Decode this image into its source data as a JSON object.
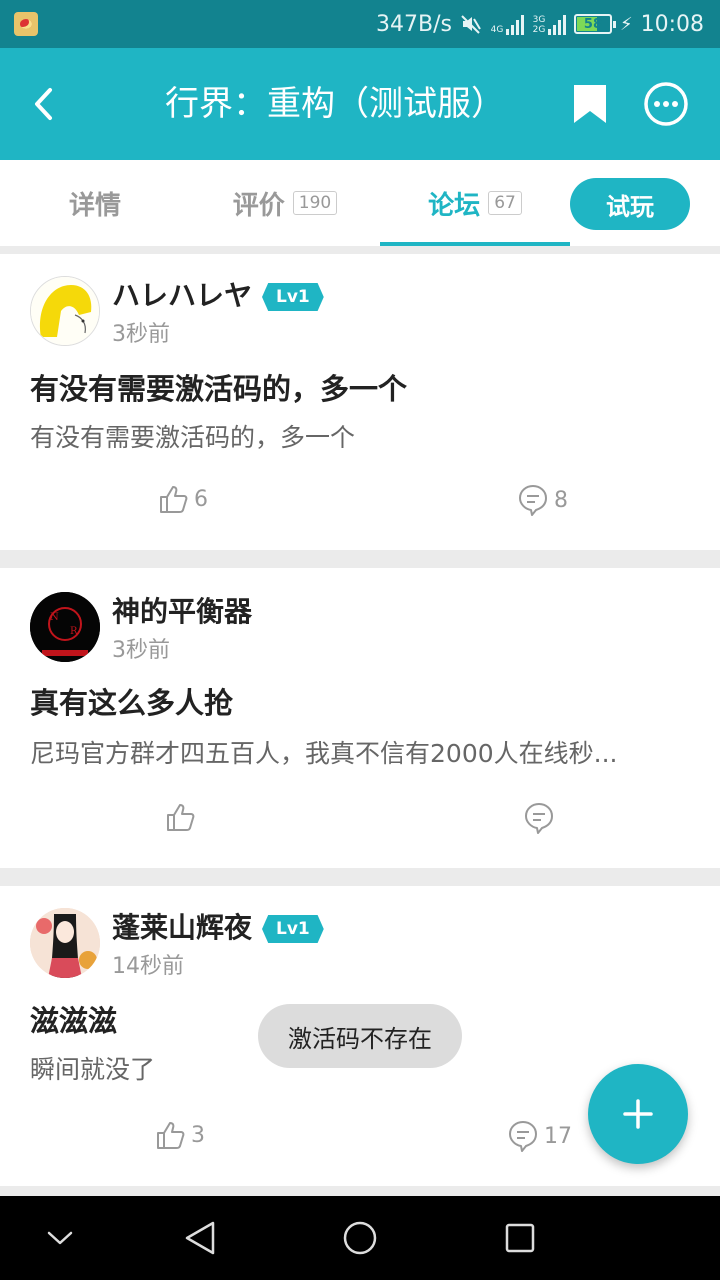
{
  "status_bar": {
    "network_speed": "347B/s",
    "signal1_label": "4G",
    "signal2_label": "3G 2G",
    "battery": "58",
    "time": "10:08"
  },
  "header": {
    "title": "行界：重构（测试服）",
    "icons": [
      "back-icon",
      "bookmark-icon",
      "more-icon"
    ]
  },
  "tabs": [
    {
      "label": "详情",
      "count": ""
    },
    {
      "label": "评价",
      "count": "190"
    },
    {
      "label": "论坛",
      "count": "67"
    }
  ],
  "try_button": "试玩",
  "posts": [
    {
      "username": "ハレハレヤ",
      "level": "Lv1",
      "time": "3秒前",
      "title": "有没有需要激活码的，多一个",
      "body": "有没有需要激活码的，多一个",
      "likes": "6",
      "comments": "8"
    },
    {
      "username": "神的平衡器",
      "level": "",
      "time": "3秒前",
      "title": "真有这么多人抢",
      "body": "尼玛官方群才四五百人，我真不信有2000人在线秒...",
      "likes": "",
      "comments": ""
    },
    {
      "username": "蓬莱山辉夜",
      "level": "Lv1",
      "time": "14秒前",
      "title": "滋滋滋",
      "body": "瞬间就没了",
      "likes": "3",
      "comments": "17"
    }
  ],
  "toast": "激活码不存在",
  "colors": {
    "accent": "#1fb5c4",
    "status_bar": "#12838f"
  }
}
